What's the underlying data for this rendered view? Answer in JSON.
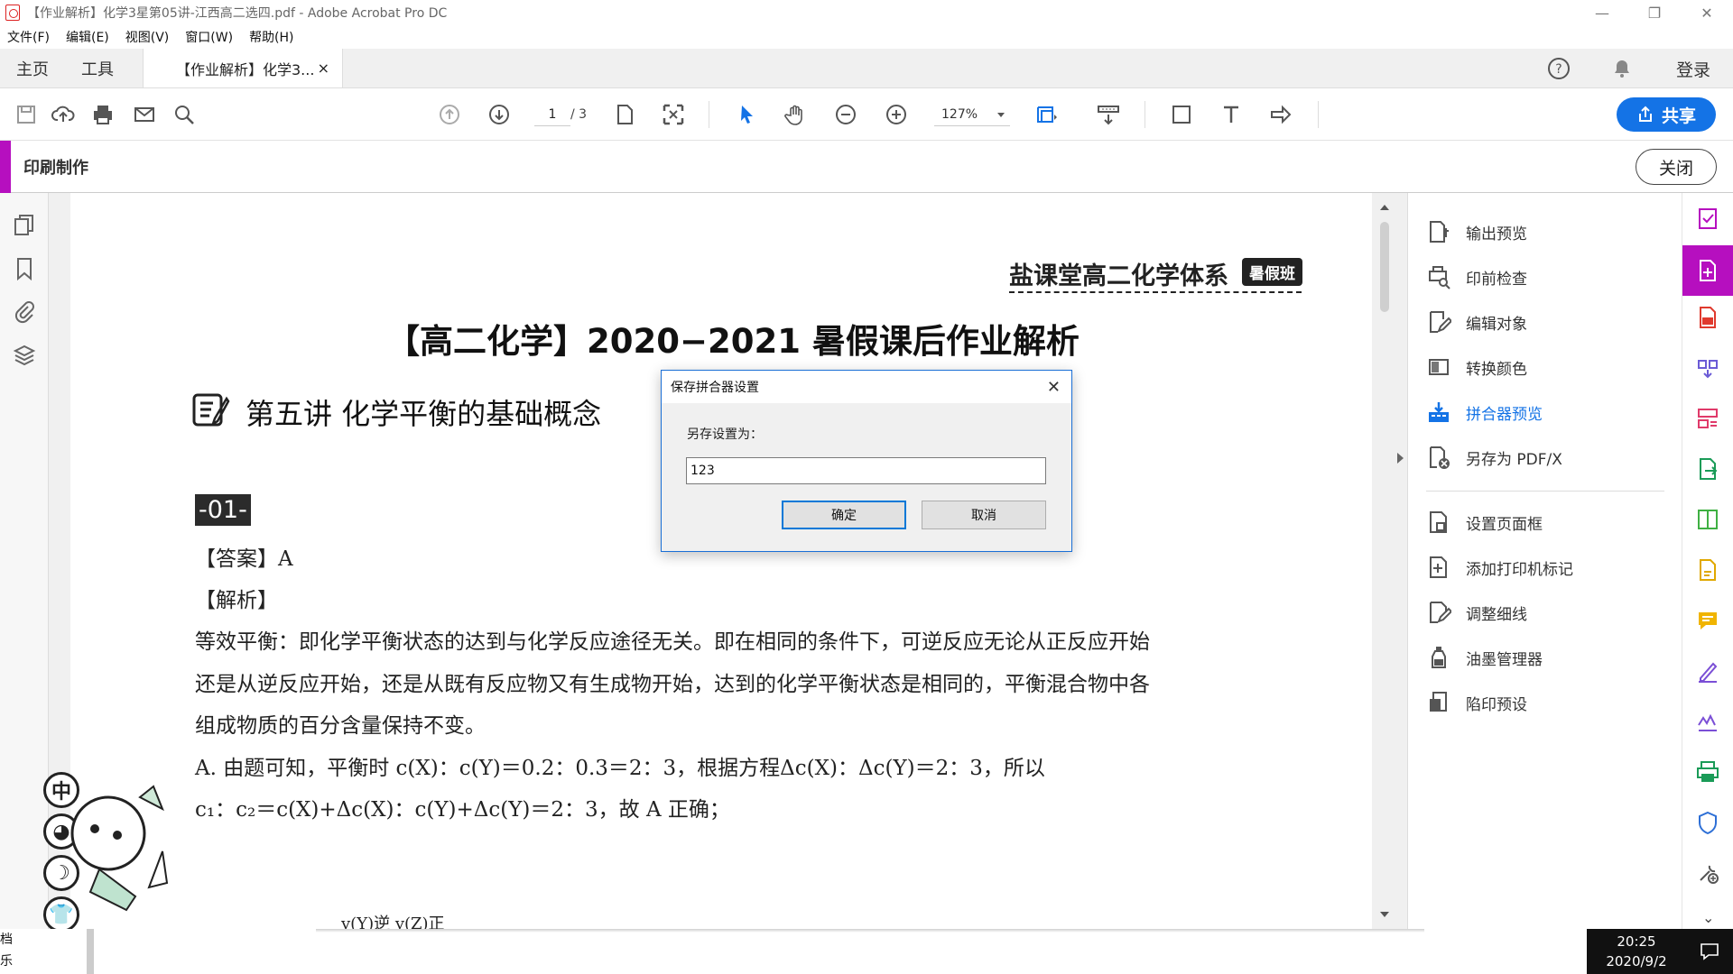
{
  "window": {
    "title": "【作业解析】化学3星第05讲-江西高二选四.pdf - Adobe Acrobat Pro DC",
    "controls": {
      "minimize": "—",
      "restore": "❐",
      "close": "✕"
    }
  },
  "menu": [
    "文件(F)",
    "编辑(E)",
    "视图(V)",
    "窗口(W)",
    "帮助(H)"
  ],
  "tabs": {
    "home": "主页",
    "tools": "工具",
    "document": "【作业解析】化学3...",
    "document_close": "×",
    "login": "登录"
  },
  "toolbar": {
    "page_current": "1",
    "page_total": "/ 3",
    "zoom": "127%",
    "share_label": "共享",
    "icons": [
      "save-icon",
      "upload-icon",
      "print-icon",
      "email-icon",
      "search-icon",
      "prev-page-icon",
      "next-page-icon",
      "page-view-icon",
      "fit-page-icon",
      "select-arrow-icon",
      "hand-icon",
      "zoom-out-icon",
      "zoom-in-icon",
      "marquee-zoom-icon",
      "scroll-mode-icon",
      "rectangle-icon",
      "text-icon",
      "forward-arrow-icon"
    ]
  },
  "mode_bar": {
    "label": "印刷制作",
    "close_label": "关闭",
    "accent": "#b60fbf"
  },
  "document": {
    "brand": "盐课堂高二化学体系",
    "brand_badge": "暑假班",
    "title": "【高二化学】2020−2021 暑假课后作业解析",
    "lesson": "第五讲  化学平衡的基础概念",
    "question_badge": "-01-",
    "lines": [
      "【答案】A",
      "【解析】",
      "等效平衡：即化学平衡状态的达到与化学反应途径无关。即在相同的条件下，可逆反应无论从正反应开始",
      "还是从逆反应开始，还是从既有反应物又有生成物开始，达到的化学平衡状态是相同的，平衡混合物中各",
      "组成物质的百分含量保持不变。",
      "A.  由题可知，平衡时 c(X)：c(Y)＝0.2：0.3＝2：3，根据方程Δc(X)：Δc(Y)＝2：3，所以",
      "c₁：c₂＝c(X)+Δc(X)：c(Y)+Δc(Y)＝2：3，故 A 正确；",
      "v(Y)逆    v(Z)正"
    ],
    "sticker_labels": [
      "中",
      "◕",
      "☽",
      "👕"
    ]
  },
  "dialog": {
    "title": "保存拼合器设置",
    "label": "另存设置为：",
    "value": "123",
    "ok": "确定",
    "cancel": "取消",
    "close": "✕"
  },
  "tools_panel": {
    "items": [
      {
        "label": "输出预览",
        "icon": "output-preview-icon"
      },
      {
        "label": "印前检查",
        "icon": "preflight-icon"
      },
      {
        "label": "编辑对象",
        "icon": "edit-object-icon"
      },
      {
        "label": "转换颜色",
        "icon": "convert-colors-icon"
      },
      {
        "label": "拼合器预览",
        "icon": "flattener-preview-icon",
        "active": true
      },
      {
        "label": "另存为 PDF/X",
        "icon": "save-pdfx-icon"
      },
      {
        "label": "设置页面框",
        "icon": "page-boxes-icon"
      },
      {
        "label": "添加打印机标记",
        "icon": "printer-marks-icon"
      },
      {
        "label": "调整细线",
        "icon": "fix-hairlines-icon"
      },
      {
        "label": "油墨管理器",
        "icon": "ink-manager-icon"
      },
      {
        "label": "陷印预设",
        "icon": "trap-presets-icon"
      }
    ],
    "active_color": "#1473e6"
  },
  "rail": {
    "icons": [
      "checklist-icon",
      "export-pdf-icon",
      "create-pdf-icon",
      "combine-icon",
      "organize-pages-icon",
      "export-icon",
      "compress-icon",
      "edit-pdf-icon",
      "comment-icon",
      "fill-sign-icon",
      "certificate-icon",
      "print-production-icon",
      "protect-icon",
      "more-tools-icon"
    ]
  },
  "taskbar": {
    "left_lines": [
      "档",
      "乐"
    ],
    "time": "20:25",
    "date": "2020/9/2"
  }
}
